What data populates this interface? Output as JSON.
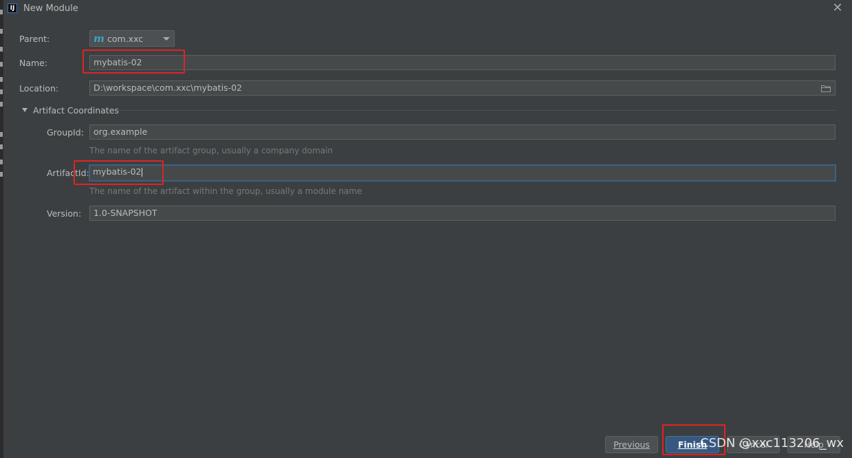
{
  "window": {
    "title": "New Module",
    "app_icon": "IJ"
  },
  "form": {
    "parent": {
      "label": "Parent:",
      "value": "com.xxc",
      "icon": "maven-m-icon",
      "icon_glyph": "m"
    },
    "name": {
      "label": "Name:",
      "value": "mybatis-02"
    },
    "location": {
      "label": "Location:",
      "value": "D:\\workspace\\com.xxc\\mybatis-02"
    },
    "artifact_section": {
      "title": "Artifact Coordinates"
    },
    "group_id": {
      "label": "GroupId:",
      "value": "org.example",
      "hint": "The name of the artifact group, usually a company domain"
    },
    "artifact_id": {
      "label": "ArtifactId:",
      "value": "mybatis-02",
      "hint": "The name of the artifact within the group, usually a module name"
    },
    "version": {
      "label": "Version:",
      "value": "1.0-SNAPSHOT"
    }
  },
  "buttons": {
    "previous": "Previous",
    "finish": "Finish",
    "cancel": "Cancel",
    "help": "Help"
  },
  "watermark": "CSDN @xxc113206_wx",
  "colors": {
    "background": "#3c3f41",
    "field": "#45494a",
    "accent": "#365880",
    "highlight": "#e02424"
  }
}
